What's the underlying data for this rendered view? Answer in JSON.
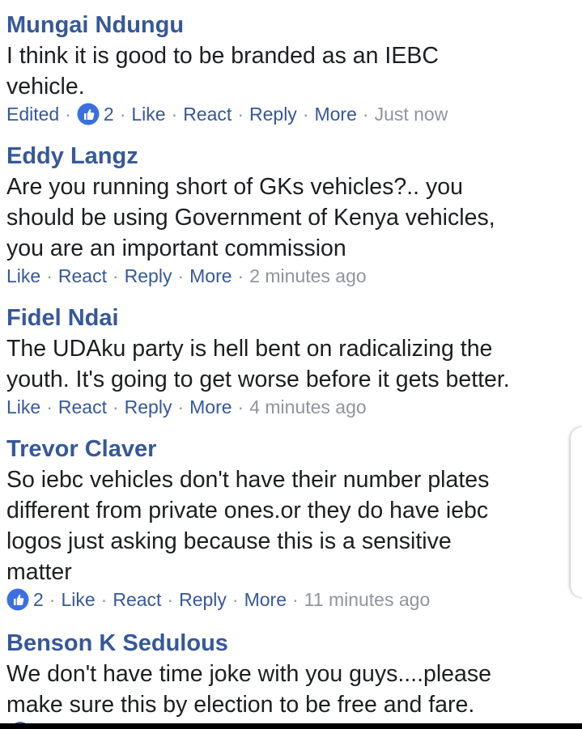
{
  "colors": {
    "author": "#365899",
    "body_text": "#1c1e21",
    "meta": "#90949c",
    "like_badge": "#3b6fe0"
  },
  "icons": {
    "like_badge": "thumbs-up-icon"
  },
  "separator": "·",
  "comments": [
    {
      "author": "Mungai Ndungu",
      "text_lines": [
        "I think it is good to be branded as an IEBC",
        "vehicle."
      ],
      "edited": "Edited",
      "like_count": "2",
      "actions": {
        "like": "Like",
        "react": "React",
        "reply": "Reply",
        "more": "More"
      },
      "time": "Just now"
    },
    {
      "author": "Eddy Langz",
      "text_lines": [
        "Are you running short of GKs vehicles?.. you",
        "should be using Government of Kenya vehicles,",
        "you are an important commission"
      ],
      "actions": {
        "like": "Like",
        "react": "React",
        "reply": "Reply",
        "more": "More"
      },
      "time": "2 minutes ago"
    },
    {
      "author": "Fidel Ndai",
      "text_lines": [
        "The UDAku party is hell bent on radicalizing the",
        "youth. It's going to get worse before it gets better."
      ],
      "actions": {
        "like": "Like",
        "react": "React",
        "reply": "Reply",
        "more": "More"
      },
      "time": "4 minutes ago"
    },
    {
      "author": "Trevor Claver",
      "text_lines": [
        "So iebc vehicles don't have their number plates",
        "different from private ones.or they do have iebc",
        "logos just asking because this is a sensitive",
        "matter"
      ],
      "like_count": "2",
      "actions": {
        "like": "Like",
        "react": "React",
        "reply": "Reply",
        "more": "More"
      },
      "time": "11 minutes ago"
    },
    {
      "author": "Benson K Sedulous",
      "text_lines": [
        "We don't have time joke with you guys....please",
        "make sure this by election to be free and fare."
      ]
    }
  ]
}
